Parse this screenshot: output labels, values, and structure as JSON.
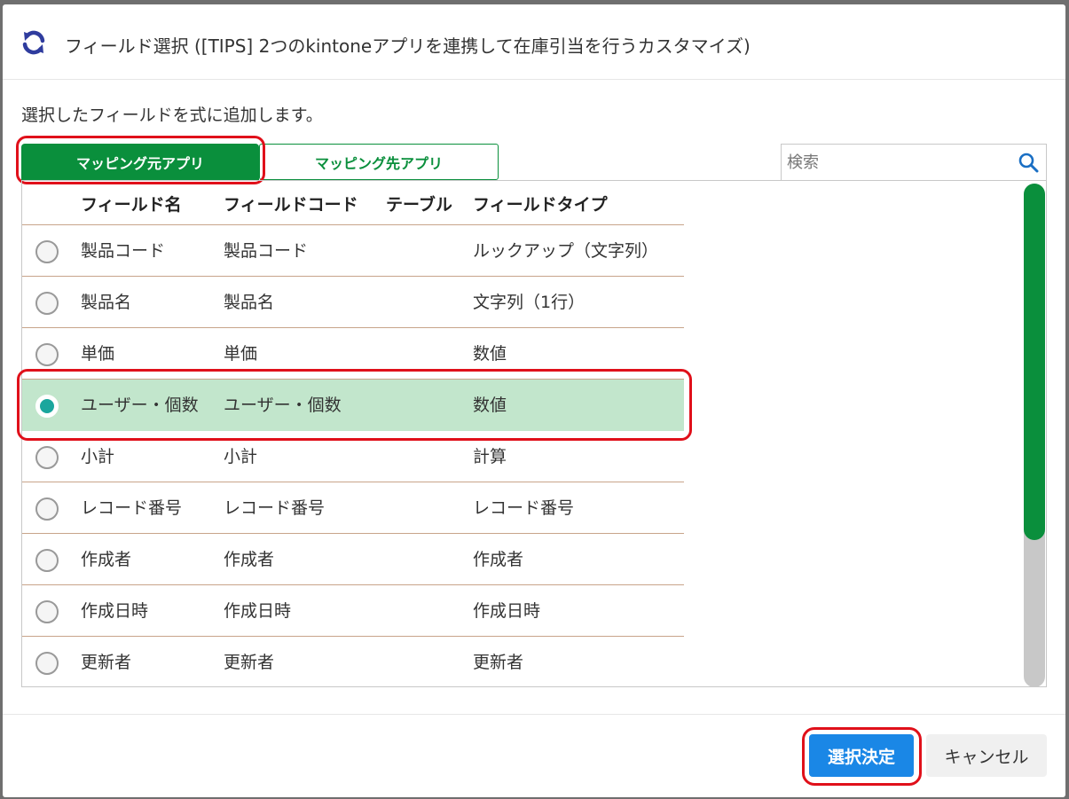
{
  "dialog": {
    "title": "フィールド選択 ([TIPS] 2つのkintoneアプリを連携して在庫引当を行うカスタマイズ)",
    "description": "選択したフィールドを式に追加します。",
    "header_icon": "refresh-icon"
  },
  "tabs": [
    {
      "label": "マッピング元アプリ",
      "active": true
    },
    {
      "label": "マッピング先アプリ",
      "active": false
    }
  ],
  "search": {
    "placeholder": "検索",
    "value": "",
    "icon": "search-icon"
  },
  "table": {
    "columns": [
      "フィールド名",
      "フィールドコード",
      "テーブル",
      "フィールドタイプ"
    ],
    "rows": [
      {
        "name": "製品コード",
        "code": "製品コード",
        "table": "",
        "type": "ルックアップ（文字列）",
        "selected": false
      },
      {
        "name": "製品名",
        "code": "製品名",
        "table": "",
        "type": "文字列（1行）",
        "selected": false
      },
      {
        "name": "単価",
        "code": "単価",
        "table": "",
        "type": "数値",
        "selected": false
      },
      {
        "name": "ユーザー・個数",
        "code": "ユーザー・個数",
        "table": "",
        "type": "数値",
        "selected": true
      },
      {
        "name": "小計",
        "code": "小計",
        "table": "",
        "type": "計算",
        "selected": false
      },
      {
        "name": "レコード番号",
        "code": "レコード番号",
        "table": "",
        "type": "レコード番号",
        "selected": false
      },
      {
        "name": "作成者",
        "code": "作成者",
        "table": "",
        "type": "作成者",
        "selected": false
      },
      {
        "name": "作成日時",
        "code": "作成日時",
        "table": "",
        "type": "作成日時",
        "selected": false
      },
      {
        "name": "更新者",
        "code": "更新者",
        "table": "",
        "type": "更新者",
        "selected": false
      }
    ]
  },
  "footer": {
    "ok_label": "選択決定",
    "cancel_label": "キャンセル"
  },
  "colors": {
    "accent_green": "#0a8f3c",
    "primary_blue": "#1a87e6",
    "highlight_red": "#e0101a",
    "selected_row": "#c2e6cc"
  }
}
